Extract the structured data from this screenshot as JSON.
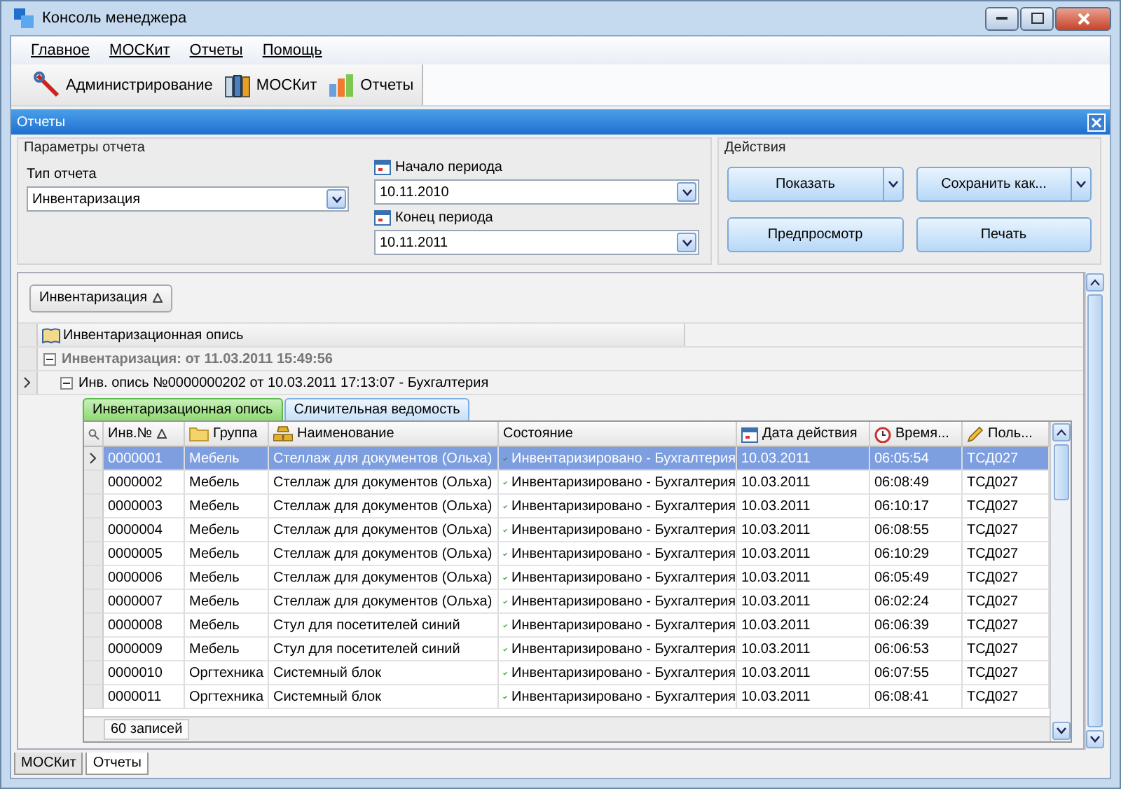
{
  "window": {
    "title": "Консоль менеджера"
  },
  "menu": [
    {
      "label": "Главное"
    },
    {
      "label": "МОСКит"
    },
    {
      "label": "Отчеты"
    },
    {
      "label": "Помощь"
    }
  ],
  "toolbar": [
    {
      "label": "Администрирование"
    },
    {
      "label": "МОСКит"
    },
    {
      "label": "Отчеты"
    }
  ],
  "panel": {
    "title": "Отчеты"
  },
  "params": {
    "legend": "Параметры отчета",
    "report_type": {
      "label": "Тип отчета",
      "value": "Инвентаризация"
    },
    "period_start": {
      "label": "Начало периода",
      "value": "10.11.2010"
    },
    "period_end": {
      "label": "Конец периода",
      "value": "10.11.2011"
    }
  },
  "actions": {
    "legend": "Действия",
    "buttons": [
      {
        "label": "Показать",
        "kind": "split"
      },
      {
        "label": "Сохранить как...",
        "kind": "split"
      },
      {
        "label": "Предпросмотр",
        "kind": "plain"
      },
      {
        "label": "Печать",
        "kind": "plain"
      }
    ]
  },
  "grid": {
    "group_chip": "Инвентаризация",
    "band_header": "Инвентаризационная опись",
    "group_row": {
      "label": "Инвентаризация: от 11.03.2011 15:49:56",
      "expanded": true
    },
    "subgroup_row": {
      "label": "Инв. опись №0000000202 от 10.03.2011 17:13:07 - Бухгалтерия",
      "expanded": true
    },
    "detail_tabs": [
      {
        "label": "Инвентаризационная опись",
        "selected": true
      },
      {
        "label": "Сличительная ведомость",
        "selected": false
      }
    ],
    "columns": [
      {
        "label": "Инв.№",
        "sorted": true
      },
      {
        "label": "Группа",
        "sorted": false
      },
      {
        "label": "Наименование",
        "sorted": false
      },
      {
        "label": "Состояние",
        "sorted": false
      },
      {
        "label": "Дата действия",
        "sorted": false
      },
      {
        "label": "Время...",
        "sorted": false
      },
      {
        "label": "Поль...",
        "sorted": false
      }
    ],
    "rows": [
      {
        "selected": true,
        "cells": [
          "0000001",
          "Мебель",
          "Стеллаж для документов (Ольха)",
          "Инвентаризировано - Бухгалтерия",
          "10.03.2011",
          "06:05:54",
          "ТСД027"
        ]
      },
      {
        "selected": false,
        "cells": [
          "0000002",
          "Мебель",
          "Стеллаж для документов (Ольха)",
          "Инвентаризировано - Бухгалтерия",
          "10.03.2011",
          "06:08:49",
          "ТСД027"
        ]
      },
      {
        "selected": false,
        "cells": [
          "0000003",
          "Мебель",
          "Стеллаж для документов (Ольха)",
          "Инвентаризировано - Бухгалтерия",
          "10.03.2011",
          "06:10:17",
          "ТСД027"
        ]
      },
      {
        "selected": false,
        "cells": [
          "0000004",
          "Мебель",
          "Стеллаж для документов (Ольха)",
          "Инвентаризировано - Бухгалтерия",
          "10.03.2011",
          "06:08:55",
          "ТСД027"
        ]
      },
      {
        "selected": false,
        "cells": [
          "0000005",
          "Мебель",
          "Стеллаж для документов (Ольха)",
          "Инвентаризировано - Бухгалтерия",
          "10.03.2011",
          "06:10:29",
          "ТСД027"
        ]
      },
      {
        "selected": false,
        "cells": [
          "0000006",
          "Мебель",
          "Стеллаж для документов (Ольха)",
          "Инвентаризировано - Бухгалтерия",
          "10.03.2011",
          "06:05:49",
          "ТСД027"
        ]
      },
      {
        "selected": false,
        "cells": [
          "0000007",
          "Мебель",
          "Стеллаж для документов (Ольха)",
          "Инвентаризировано - Бухгалтерия",
          "10.03.2011",
          "06:02:24",
          "ТСД027"
        ]
      },
      {
        "selected": false,
        "cells": [
          "0000008",
          "Мебель",
          "Стул для посетителей синий",
          "Инвентаризировано - Бухгалтерия",
          "10.03.2011",
          "06:06:39",
          "ТСД027"
        ]
      },
      {
        "selected": false,
        "cells": [
          "0000009",
          "Мебель",
          "Стул для посетителей синий",
          "Инвентаризировано - Бухгалтерия",
          "10.03.2011",
          "06:06:53",
          "ТСД027"
        ]
      },
      {
        "selected": false,
        "cells": [
          "0000010",
          "Оргтехника",
          "Системный блок",
          "Инвентаризировано - Бухгалтерия",
          "10.03.2011",
          "06:07:55",
          "ТСД027"
        ]
      },
      {
        "selected": false,
        "cells": [
          "0000011",
          "Оргтехника",
          "Системный блок",
          "Инвентаризировано - Бухгалтерия",
          "10.03.2011",
          "06:08:41",
          "ТСД027"
        ]
      }
    ],
    "footer": "60 записей"
  },
  "bottom_tabs": [
    {
      "label": "МОСКит",
      "selected": false
    },
    {
      "label": "Отчеты",
      "selected": true
    }
  ]
}
